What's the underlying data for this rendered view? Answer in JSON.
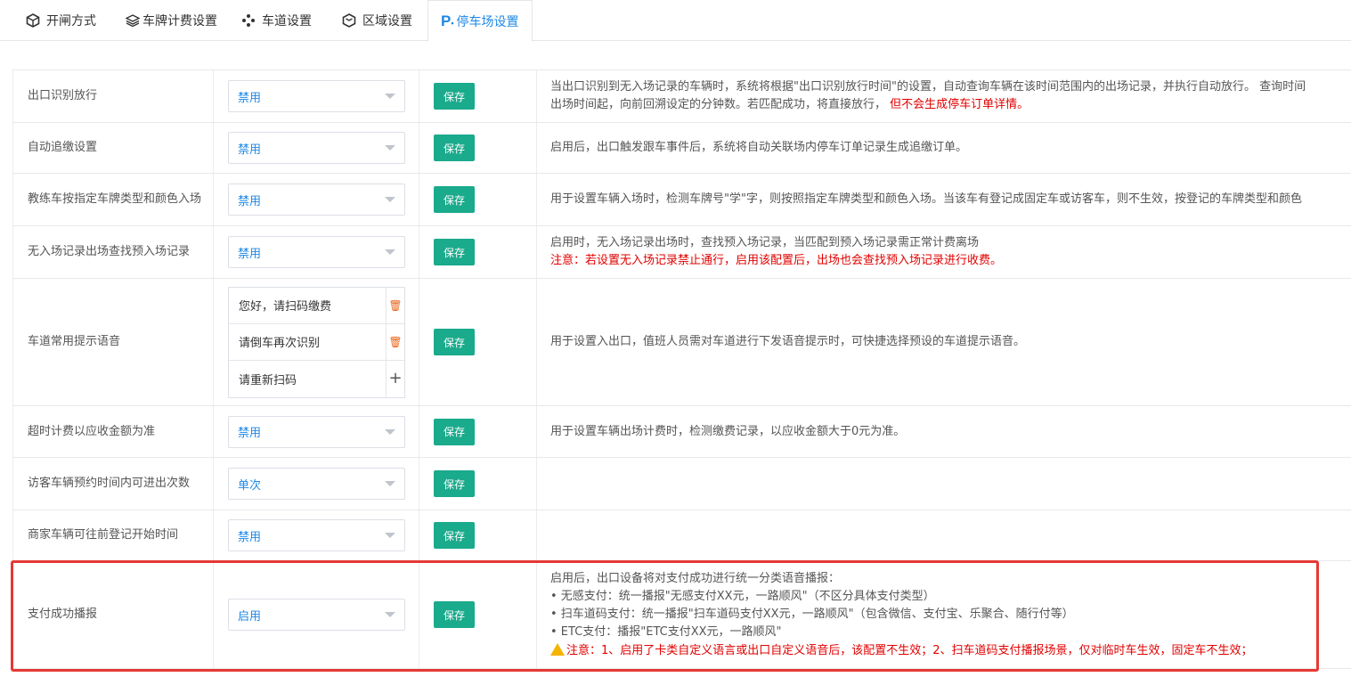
{
  "tabs": [
    {
      "label": "开闸方式",
      "icon": "cube-icon",
      "active": false
    },
    {
      "label": "车牌计费设置",
      "icon": "layers-icon",
      "active": false
    },
    {
      "label": "车道设置",
      "icon": "lane-icon",
      "active": false
    },
    {
      "label": "区域设置",
      "icon": "box-icon",
      "active": false
    },
    {
      "label": "停车场设置",
      "icon": "parking-icon",
      "active": true
    }
  ],
  "save_label": "保存",
  "rows": [
    {
      "name": "出口识别放行",
      "select": "禁用",
      "desc_line1": "当出口识别到无入场记录的车辆时，系统将根据\"出口识别放行时间\"的设置，自动查询车辆在该时间范围内的出场记录，并执行自动放行。 查询时间",
      "desc_line2": "出场时间起，向前回溯设定的分钟数。若匹配成功，将直接放行，",
      "desc_line2_red": "但不会生成停车订单详情。"
    },
    {
      "name": "自动追缴设置",
      "select": "禁用",
      "desc_line1": "启用后，出口触发跟车事件后，系统将自动关联场内停车订单记录生成追缴订单。"
    },
    {
      "name": "教练车按指定车牌类型和颜色入场",
      "select": "禁用",
      "desc_line1": "用于设置车辆入场时，检测车牌号\"学\"字，则按照指定车牌类型和颜色入场。当该车有登记成固定车或访客车，则不生效，按登记的车牌类型和颜色"
    },
    {
      "name": "无入场记录出场查找预入场记录",
      "select": "禁用",
      "desc_line1": "启用时，无入场记录出场时，查找预入场记录，当匹配到预入场记录需正常计费离场",
      "desc_line2_red": "注意：若设置无入场记录禁止通行，启用该配置后，出场也会查找预入场记录进行收费。"
    },
    {
      "name": "车道常用提示语音",
      "voices": [
        "您好，请扫码缴费",
        "请倒车再次识别",
        "请重新扫码"
      ],
      "desc_line1": "用于设置入出口，值班人员需对车道进行下发语音提示时，可快捷选择预设的车道提示语音。"
    },
    {
      "name": "超时计费以应收金额为准",
      "select": "禁用",
      "desc_line1": "用于设置车辆出场计费时，检测缴费记录，以应收金额大于0元为准。"
    },
    {
      "name": "访客车辆预约时间内可进出次数",
      "select": "单次",
      "desc_line1": ""
    },
    {
      "name": "商家车辆可往前登记开始时间",
      "select": "禁用",
      "desc_line1": ""
    },
    {
      "name": "支付成功播报",
      "select": "启用",
      "desc_line1": "启用后，出口设备将对支付成功进行统一分类语音播报：",
      "desc_line2": "• 无感支付：统一播报\"无感支付XX元，一路顺风\"（不区分具体支付类型）",
      "desc_line3": "• 扫车道码支付：统一播报\"扫车道码支付XX元，一路顺风\"（包含微信、支付宝、乐聚合、随行付等）",
      "desc_line4": "• ETC支付：播报\"ETC支付XX元，一路顺风\"",
      "desc_line5_red": "注意：1、启用了卡类自定义语言或出口自定义语音后，该配置不生效；2、扫车道码支付播报场景，仅对临时车生效，固定车不生效；"
    }
  ],
  "colors": {
    "accent": "#1e88e5",
    "save": "#1aaa8c",
    "warn": "#e10000",
    "highlight": "#e53935"
  }
}
